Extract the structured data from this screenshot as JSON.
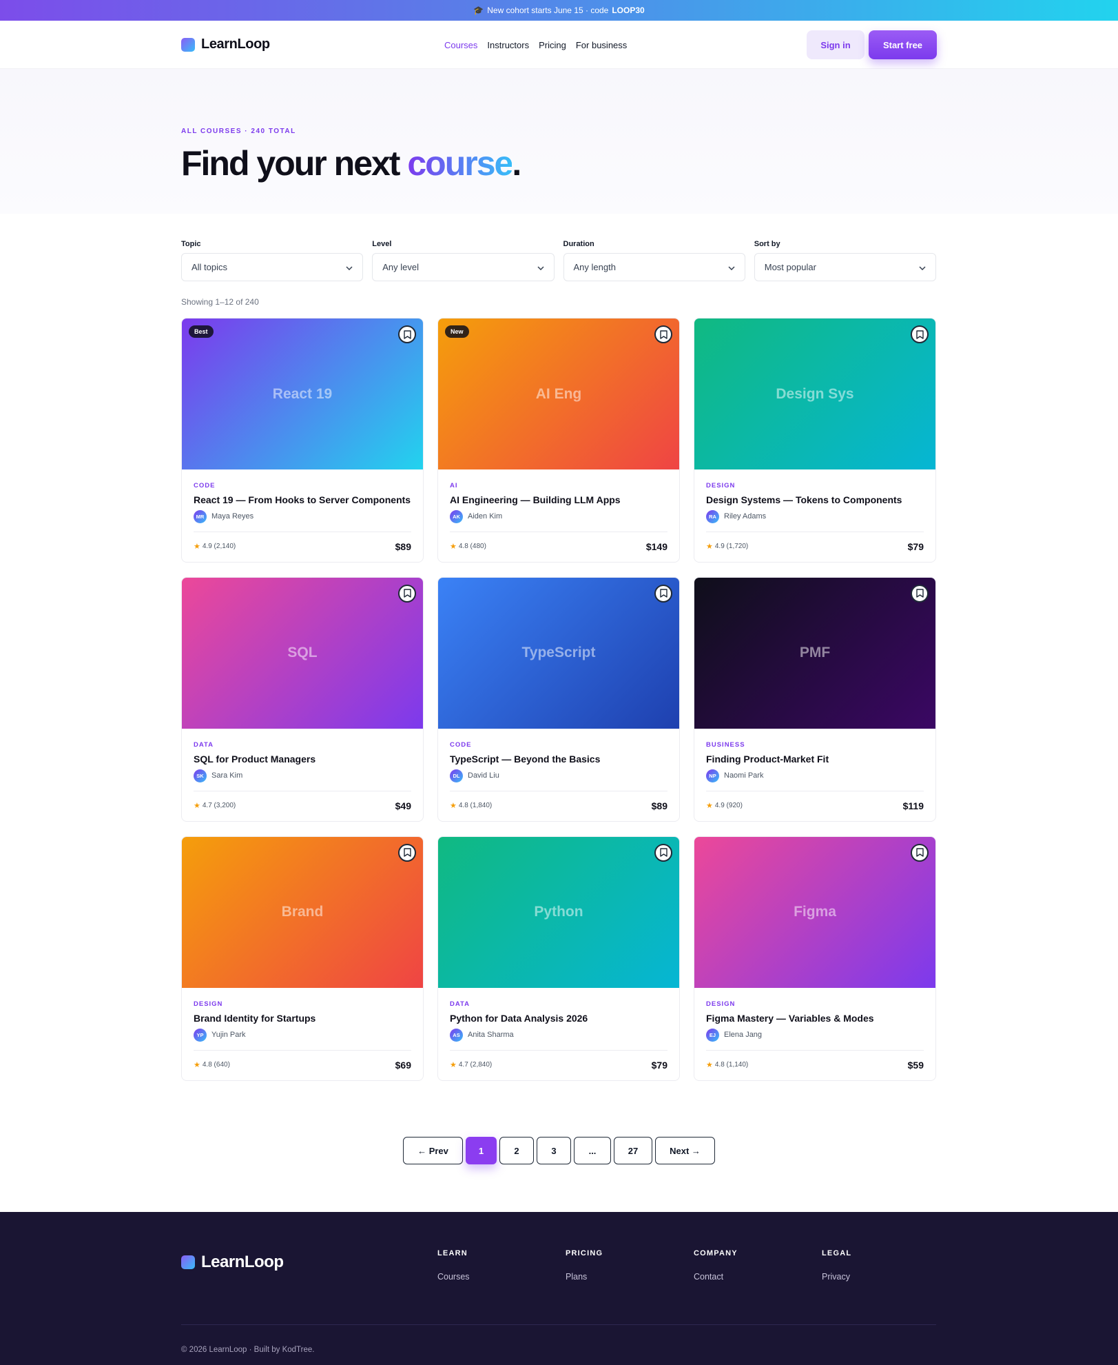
{
  "promo": {
    "icon": "graduation-cap-icon",
    "text": "New cohort starts June 15 · code",
    "code": "LOOP30"
  },
  "brand": {
    "name": "LearnLoop"
  },
  "nav": {
    "links": [
      {
        "label": "Courses",
        "active": true
      },
      {
        "label": "Instructors",
        "active": false
      },
      {
        "label": "Pricing",
        "active": false
      },
      {
        "label": "For business",
        "active": false
      }
    ],
    "signin": "Sign in",
    "start": "Start free"
  },
  "hero": {
    "eyebrow": "ALL COURSES · 240 TOTAL",
    "title_a": "Find your next ",
    "title_b": "course",
    "title_c": "."
  },
  "filters": [
    {
      "label": "Topic",
      "value": "All topics"
    },
    {
      "label": "Level",
      "value": "Any level"
    },
    {
      "label": "Duration",
      "value": "Any length"
    },
    {
      "label": "Sort by",
      "value": "Most popular"
    }
  ],
  "showing": "Showing 1–12 of 240",
  "courses": [
    {
      "thumb": "React 19",
      "badge": "Best",
      "category": "CODE",
      "title": "React 19 — From Hooks to Server Components",
      "initials": "MR",
      "instructor": "Maya Reyes",
      "rating": "4.9 (2,140)",
      "price": "$89",
      "grad": [
        "#7c3aed",
        "#22d3ee"
      ]
    },
    {
      "thumb": "AI Eng",
      "badge": "New",
      "category": "AI",
      "title": "AI Engineering — Building LLM Apps",
      "initials": "AK",
      "instructor": "Aiden Kim",
      "rating": "4.8 (480)",
      "price": "$149",
      "grad": [
        "#f59e0b",
        "#ef4444"
      ]
    },
    {
      "thumb": "Design Sys",
      "badge": "",
      "category": "DESIGN",
      "title": "Design Systems — Tokens to Components",
      "initials": "RA",
      "instructor": "Riley Adams",
      "rating": "4.9 (1,720)",
      "price": "$79",
      "grad": [
        "#10b981",
        "#06b6d4"
      ]
    },
    {
      "thumb": "SQL",
      "badge": "",
      "category": "DATA",
      "title": "SQL for Product Managers",
      "initials": "SK",
      "instructor": "Sara Kim",
      "rating": "4.7 (3,200)",
      "price": "$49",
      "grad": [
        "#ec4899",
        "#7c3aed"
      ]
    },
    {
      "thumb": "TypeScript",
      "badge": "",
      "category": "CODE",
      "title": "TypeScript — Beyond the Basics",
      "initials": "DL",
      "instructor": "David Liu",
      "rating": "4.8 (1,840)",
      "price": "$89",
      "grad": [
        "#3b82f6",
        "#1e40af"
      ]
    },
    {
      "thumb": "PMF",
      "badge": "",
      "category": "BUSINESS",
      "title": "Finding Product-Market Fit",
      "initials": "NP",
      "instructor": "Naomi Park",
      "rating": "4.9 (920)",
      "price": "$119",
      "grad": [
        "#0f0f1a",
        "#3b0764"
      ]
    },
    {
      "thumb": "Brand",
      "badge": "",
      "category": "DESIGN",
      "title": "Brand Identity for Startups",
      "initials": "YP",
      "instructor": "Yujin Park",
      "rating": "4.8 (640)",
      "price": "$69",
      "grad": [
        "#f59e0b",
        "#ef4444"
      ]
    },
    {
      "thumb": "Python",
      "badge": "",
      "category": "DATA",
      "title": "Python for Data Analysis 2026",
      "initials": "AS",
      "instructor": "Anita Sharma",
      "rating": "4.7 (2,840)",
      "price": "$79",
      "grad": [
        "#10b981",
        "#06b6d4"
      ]
    },
    {
      "thumb": "Figma",
      "badge": "",
      "category": "DESIGN",
      "title": "Figma Mastery — Variables & Modes",
      "initials": "EJ",
      "instructor": "Elena Jang",
      "rating": "4.8 (1,140)",
      "price": "$59",
      "grad": [
        "#ec4899",
        "#7c3aed"
      ]
    }
  ],
  "pagination": {
    "prev": "← Prev",
    "pages": [
      "1",
      "2",
      "3",
      "...",
      "27"
    ],
    "current": "1",
    "next": "Next →"
  },
  "footer": {
    "columns": [
      {
        "heading": "LEARN",
        "link": "Courses"
      },
      {
        "heading": "PRICING",
        "link": "Plans"
      },
      {
        "heading": "COMPANY",
        "link": "Contact"
      },
      {
        "heading": "LEGAL",
        "link": "Privacy"
      }
    ],
    "copyright": "© 2026 LearnLoop · Built by KodTree."
  },
  "colors": {
    "accent": "#7c3aed",
    "footer_bg": "#1a1533"
  }
}
